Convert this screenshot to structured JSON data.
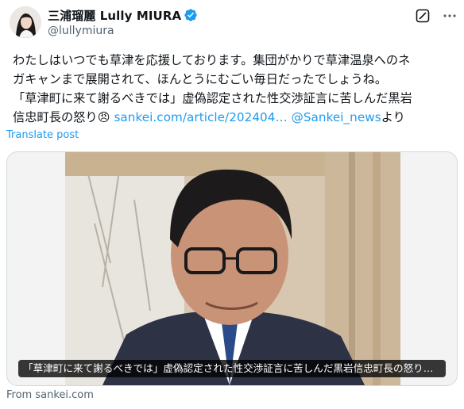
{
  "author": {
    "display_name": "三浦瑠麗 Lully MIURA",
    "handle": "@lullymiura",
    "verified": true
  },
  "icons": {
    "avatar": "profile-photo",
    "verified": "verified-badge-icon",
    "grok": "grok-icon",
    "more": "more-options-icon",
    "emoji": "angry-face-emoji"
  },
  "tweet": {
    "line1": "わたしはいつでも草津を応援しております。集団がかりで草津温泉へのネ",
    "line2": "ガキャンまで展開されて、ほんとうにむごい毎日だったでしょうね。",
    "line3": "「草津町に来て謝るべきでは」虚偽認定された性交渉証言に苦しんだ黒岩",
    "line4_prefix": "信忠町長の怒り",
    "emoji": "😠",
    "link_url": "sankei.com/article/202404…",
    "mention": "@Sankei_news",
    "suffix": "より"
  },
  "translate_label": "Translate post",
  "card": {
    "caption": "「草津町に来て謝るべきでは」虚偽認定された性交渉証言に苦しんだ黒岩信忠町長の怒り…",
    "source": "From sankei.com"
  },
  "colors": {
    "accent": "#1d9bf0",
    "text": "#0f1419",
    "secondary": "#536471",
    "border": "#cfd9de"
  }
}
